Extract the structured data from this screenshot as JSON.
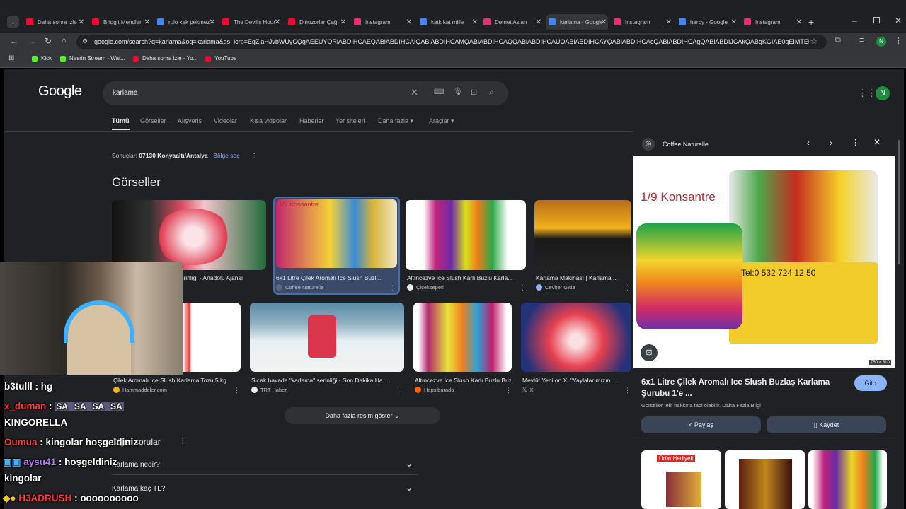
{
  "tabs": [
    {
      "title": "Daha sonra izle",
      "color": "#ff0033"
    },
    {
      "title": "Bridgit Mendler",
      "color": "#ff0033"
    },
    {
      "title": "rulo kek pekmez",
      "color": "#4285f4"
    },
    {
      "title": "The Devil's Hour",
      "color": "#ff0033"
    },
    {
      "title": "Dinozorlar Çağı",
      "color": "#ff0033"
    },
    {
      "title": "Instagram",
      "color": "#e1306c"
    },
    {
      "title": "katk kat mille",
      "color": "#4285f4"
    },
    {
      "title": "Demet Aslan",
      "color": "#e1306c"
    },
    {
      "title": "karlama - Google",
      "color": "#4285f4"
    },
    {
      "title": "Instagram",
      "color": "#e1306c"
    },
    {
      "title": "harby - Google",
      "color": "#4285f4"
    },
    {
      "title": "Instagram",
      "color": "#e1306c"
    }
  ],
  "address": {
    "url": "google.com/search?q=karlama&oq=karlama&gs_lcrp=EgZjaHJvbWUyCQgAEEUYORiABDIHCAEQABiABDIHCAIQABiABDIHCAMQABiABDIHCAQQABiABDIHCAUQABiABDIHCAYQABiABDIHCAcQABiABDIHCAgQABiABDIJCAkQABgKGIAE0gEIMTE5..."
  },
  "profile_letter": "N",
  "bookmarks": [
    {
      "label": "Kick",
      "color": "#53fc18"
    },
    {
      "label": "Nesrin Stream - Wat...",
      "color": "#53fc18"
    },
    {
      "label": "Daha sonra izle - Yo...",
      "color": "#ff0033"
    },
    {
      "label": "YouTube",
      "color": "#ff0033"
    }
  ],
  "google": {
    "logo": "Google",
    "query": "karlama",
    "nav": [
      "Tümü",
      "Görseller",
      "Alışveriş",
      "Videolar",
      "Kısa videolar",
      "Haberler",
      "Yer siteleri",
      "Daha fazla",
      "Araçlar"
    ],
    "results_label": "Sonuçlar:",
    "location": "07130 Konyaaltı/Antalya",
    "region_link": "Bölge seç",
    "images_heading": "Görseller",
    "row1": [
      {
        "caption": "Sıcak havada \"karlama\" serinliği - Anadolu Ajansı",
        "source": ""
      },
      {
        "caption": "6x1 Litre Çilek Aromalı Ice Slush Buzl...",
        "source": "Coffee Naturelle"
      },
      {
        "caption": "Altıncezve Ice Slush Karlı Buzlu Karla...",
        "source": "Çiçeksepeti"
      },
      {
        "caption": "Karlama Makinası | Karlama ...",
        "source": "Cevher Gıda"
      }
    ],
    "row2": [
      {
        "caption": "Çilek Aromalı Ice Slush Karlama Tozu 5 kg",
        "source": "Hammaddeler.com"
      },
      {
        "caption": "Sıcak havada \"karlama\" serinliği - Son Dakika Ha...",
        "source": "TRT Haber"
      },
      {
        "caption": "Altıncezve Ice Slush Karlı Buzlu Buzl...",
        "source": "Hepsiburada"
      },
      {
        "caption": "Mevlüt Yeni on X: \"Yaylalarımızın ...",
        "source": "X"
      }
    ],
    "more_images": "Daha fazla resim göster",
    "related_heading": "Diğer sorular",
    "questions": [
      "Karlama nedir?",
      "Karlama kaç TL?"
    ]
  },
  "panel": {
    "site": "Coffee Naturelle",
    "image_text_1": "1/9 Konsantre",
    "image_text_2": "Tel:0 532 724 12 50",
    "dimensions": "750 × 610",
    "title": "6x1 Litre Çilek Aromalı Ice Slush Buzlaş Karlama Şurubu 1'e ...",
    "visit": "Git",
    "copyright": "Görseller telif hakkına tabi olabilir. Daha Fazla Bilgi",
    "share": "Paylaş",
    "save": "Kaydet",
    "thumb_label": "Ürün Hediyeli"
  },
  "chat": [
    {
      "user": "b3tulll",
      "sep": " : ",
      "msg": "hg",
      "user_color": "#ffffff"
    },
    {
      "user": "x_duman",
      "sep": " : ",
      "msg": "SA  SA  SA  SA",
      "user_color": "#ff3333"
    },
    {
      "user": "",
      "sep": "",
      "msg": "KINGORELLA",
      "user_color": "#ffffff"
    },
    {
      "user": "Oumua",
      "sep": " : ",
      "msg": "kingolar hoşgeldiniz",
      "user_color": "#ff3333"
    },
    {
      "user": "aysu41",
      "sep": " : ",
      "msg": "hoşgeldiniz",
      "user_color": "#b07cff"
    },
    {
      "user": "",
      "sep": "",
      "msg": "kingolar",
      "user_color": "#ffffff"
    },
    {
      "user": "H3ADRUSH",
      "sep": " : ",
      "msg": "oooooooooo",
      "user_color": "#ff3333"
    }
  ]
}
